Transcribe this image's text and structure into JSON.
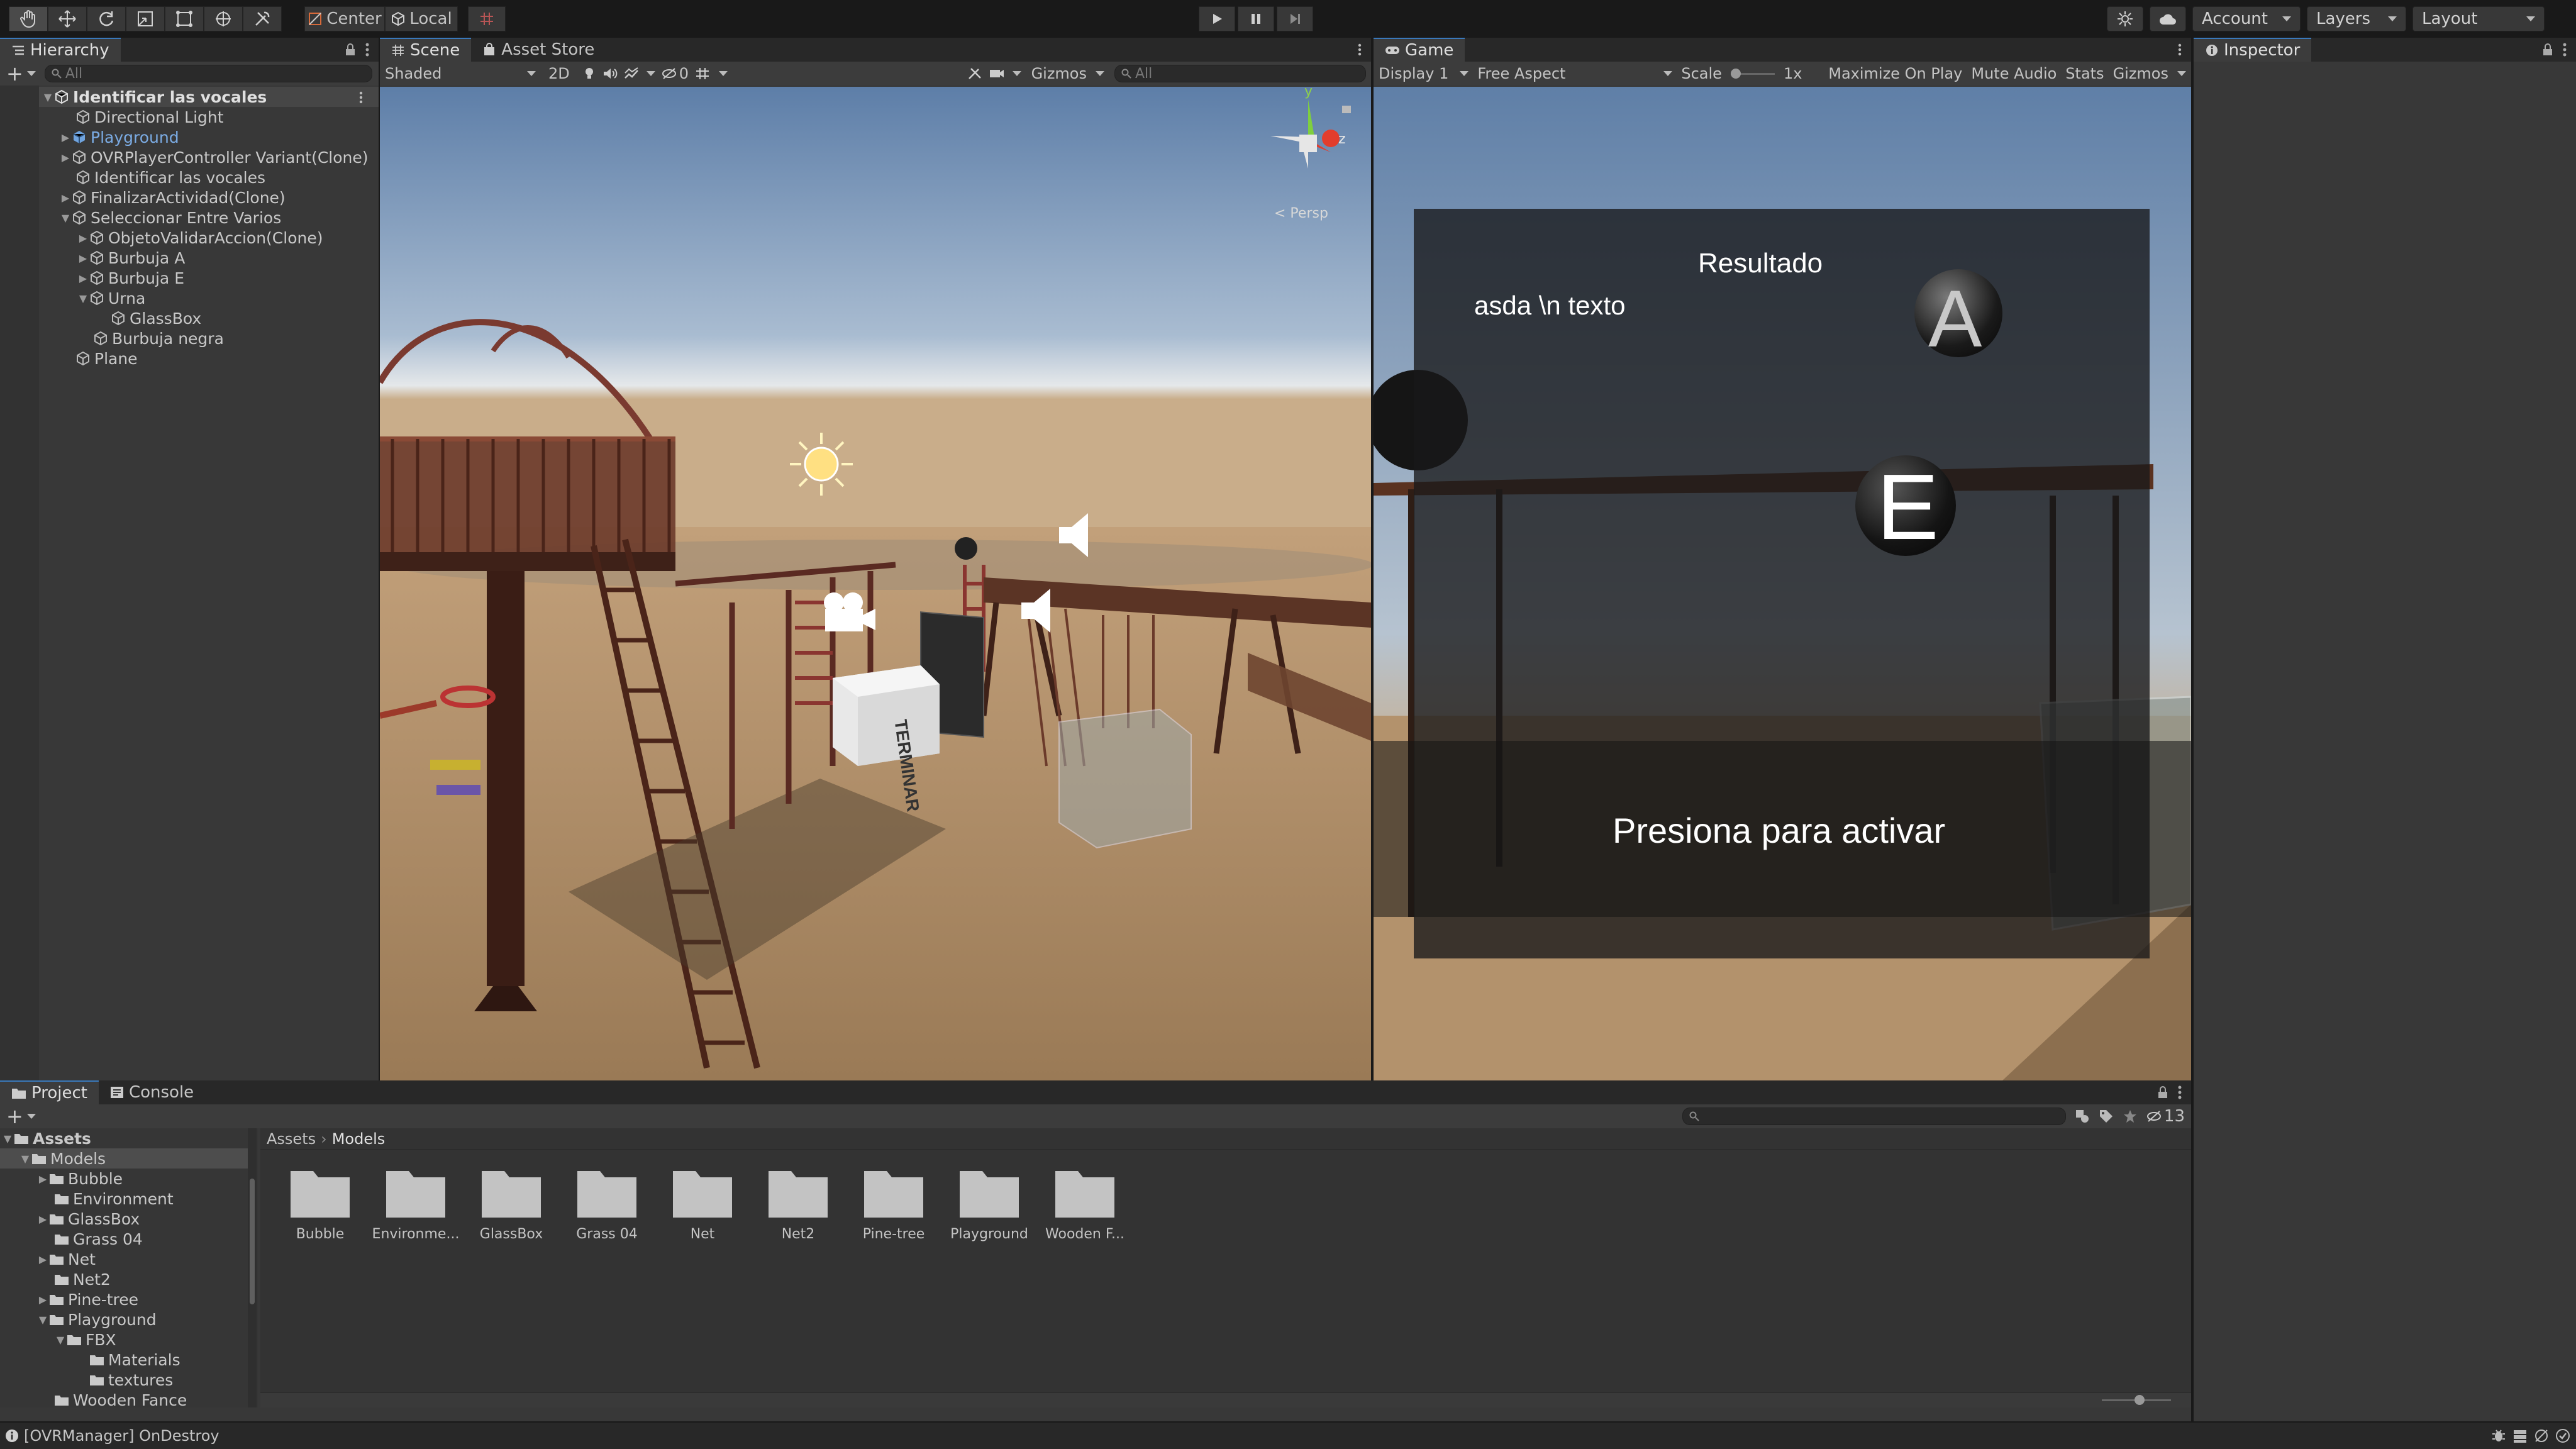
{
  "toolbar": {
    "pivot_label": "Center",
    "space_label": "Local",
    "account_label": "Account",
    "layers_label": "Layers",
    "layout_label": "Layout"
  },
  "hierarchy": {
    "tab_label": "Hierarchy",
    "search_placeholder": "All",
    "scene_name": "Identificar las vocales",
    "items": [
      {
        "label": "Directional Light"
      },
      {
        "label": "Playground"
      },
      {
        "label": "OVRPlayerController Variant(Clone)"
      },
      {
        "label": "Identificar las vocales"
      },
      {
        "label": "FinalizarActividad(Clone)"
      },
      {
        "label": "Seleccionar Entre Varios"
      },
      {
        "label": "ObjetoValidarAccion(Clone)"
      },
      {
        "label": "Burbuja A"
      },
      {
        "label": "Burbuja E"
      },
      {
        "label": "Urna"
      },
      {
        "label": "GlassBox"
      },
      {
        "label": "Burbuja negra"
      },
      {
        "label": "Plane"
      }
    ]
  },
  "scene": {
    "tab_label": "Scene",
    "asset_store_label": "Asset Store",
    "shading_mode": "Shaded",
    "mode_2d": "2D",
    "hidden_count": "0",
    "gizmos_label": "Gizmos",
    "search_placeholder": "All",
    "persp_label": "< Persp",
    "gizmo_axes": {
      "y": "y",
      "z": "z"
    },
    "cube_text": "TERMINAR"
  },
  "game": {
    "tab_label": "Game",
    "display": "Display 1",
    "aspect": "Free Aspect",
    "scale_label": "Scale",
    "scale_value": "1x",
    "maximize_label": "Maximize On Play",
    "mute_label": "Mute Audio",
    "stats_label": "Stats",
    "gizmos_label": "Gizmos",
    "resultado": "Resultado",
    "body_text": "asda \\n texto",
    "bubble_a": "A",
    "bubble_e": "E",
    "prompt": "Presiona para activar"
  },
  "inspector": {
    "tab_label": "Inspector"
  },
  "project": {
    "tab_label": "Project",
    "console_label": "Console",
    "hidden_count": "13",
    "breadcrumb_root": "Assets",
    "breadcrumb_current": "Models",
    "tree": [
      {
        "label": "Assets"
      },
      {
        "label": "Models"
      },
      {
        "label": "Bubble"
      },
      {
        "label": "Environment"
      },
      {
        "label": "GlassBox"
      },
      {
        "label": "Grass 04"
      },
      {
        "label": "Net"
      },
      {
        "label": "Net2"
      },
      {
        "label": "Pine-tree"
      },
      {
        "label": "Playground"
      },
      {
        "label": "FBX"
      },
      {
        "label": "Materials"
      },
      {
        "label": "textures"
      },
      {
        "label": "Wooden Fance"
      }
    ],
    "folders": [
      {
        "label": "Bubble"
      },
      {
        "label": "Environme..."
      },
      {
        "label": "GlassBox"
      },
      {
        "label": "Grass 04"
      },
      {
        "label": "Net"
      },
      {
        "label": "Net2"
      },
      {
        "label": "Pine-tree"
      },
      {
        "label": "Playground"
      },
      {
        "label": "Wooden F..."
      }
    ]
  },
  "status": {
    "message": "[OVRManager] OnDestroy"
  },
  "colors": {
    "accent": "#3a79bb",
    "selection": "#2c5d87",
    "prefab_blue": "#7babe3"
  }
}
